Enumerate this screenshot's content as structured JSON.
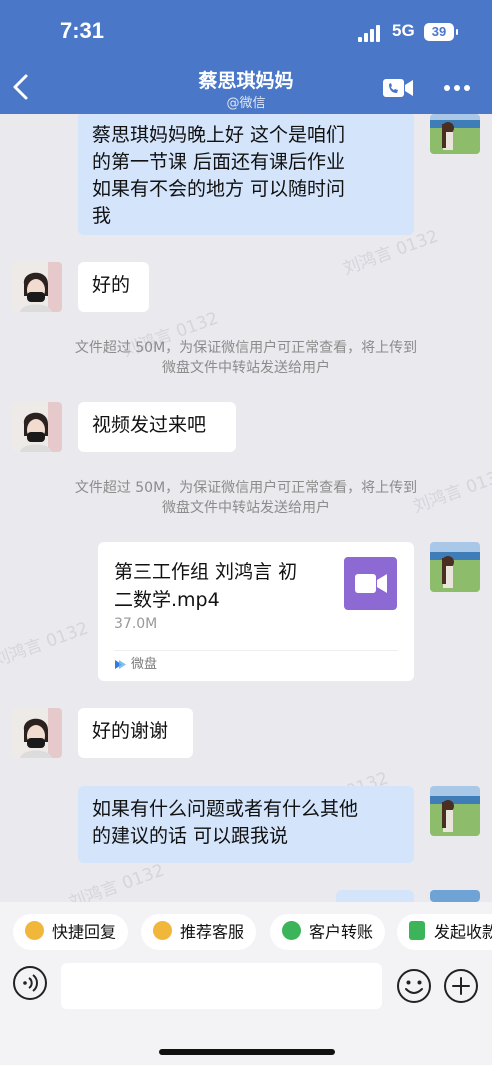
{
  "status_bar": {
    "time": "7:31",
    "network": "5G",
    "battery": "39"
  },
  "header": {
    "title": "蔡思琪妈妈",
    "subtitle": "@微信"
  },
  "messages": [
    {
      "type": "out",
      "text": [
        "蔡思琪妈妈晚上好 这个是咱们",
        "的第一节课 后面还有课后作业",
        "如果有不会的地方 可以随时问",
        "我"
      ]
    },
    {
      "type": "in",
      "text": "好的"
    },
    {
      "type": "system",
      "text": [
        "文件超过 50M，为保证微信用户可正常查看，将上传到",
        "微盘文件中转站发送给用户"
      ]
    },
    {
      "type": "in",
      "text": "视频发过来吧"
    },
    {
      "type": "system",
      "text": [
        "文件超过 50M，为保证微信用户可正常查看，将上传到",
        "微盘文件中转站发送给用户"
      ]
    },
    {
      "type": "file",
      "name": [
        "第三工作组 刘鸿言 初",
        "二数学.mp4"
      ],
      "size": "37.0M",
      "source": "微盘"
    },
    {
      "type": "in",
      "text": "好的谢谢"
    },
    {
      "type": "out",
      "text": [
        "如果有什么问题或者有什么其他",
        "的建议的话 可以跟我说"
      ]
    }
  ],
  "watermark": "刘鸿言 0132",
  "quick_actions": [
    {
      "label": "快捷回复",
      "color": "#f0b73a"
    },
    {
      "label": "推荐客服",
      "color": "#f0b73a"
    },
    {
      "label": "客户转账",
      "color": "#3bb45a"
    },
    {
      "label": "发起收款",
      "color": "#3bb45a"
    }
  ],
  "input": {
    "placeholder": ""
  },
  "colors": {
    "header": "#4a77c8",
    "out_bubble": "#d3e4fb",
    "video_icon": "#8c69d3"
  }
}
